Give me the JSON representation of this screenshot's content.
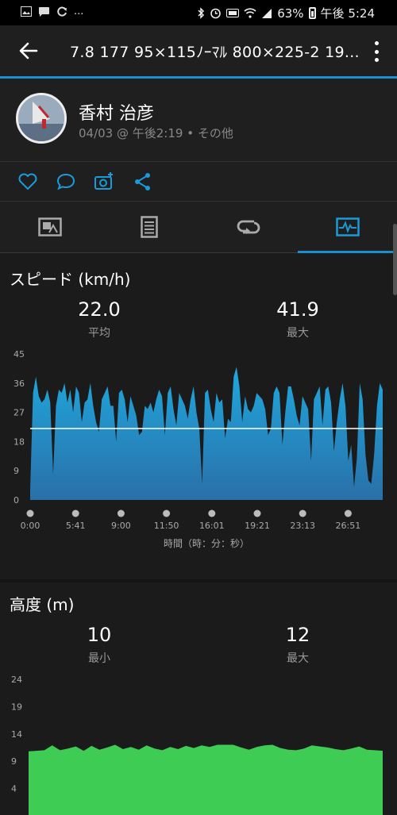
{
  "status_bar": {
    "left_icons": [
      "image-icon",
      "chat-bubble-icon",
      "sync-icon"
    ],
    "left_more": "...",
    "battery_pct": "63%",
    "time": "午後 5:24"
  },
  "app_bar": {
    "title": "7.8  177  95×115ﾉｰﾏﾙ  800×225-2  19..."
  },
  "header": {
    "user_name": "香村 治彦",
    "meta": "04/03 @ 午後2:19 • その他"
  },
  "tabs": [
    {
      "icon": "summary-icon",
      "selected": false
    },
    {
      "icon": "details-icon",
      "selected": false
    },
    {
      "icon": "laps-icon",
      "selected": false
    },
    {
      "icon": "chart-icon",
      "selected": true
    }
  ],
  "speed": {
    "title": "スピード (km/h)",
    "avg_value": "22.0",
    "avg_label": "平均",
    "max_value": "41.9",
    "max_label": "最大",
    "x_caption": "時間（時：分：秒）"
  },
  "altitude": {
    "title": "高度 (m)",
    "min_value": "10",
    "min_label": "最小",
    "max_value": "12",
    "max_label": "最大"
  },
  "chart_data": [
    {
      "type": "area",
      "ylabel": "スピード (km/h)",
      "xlabel": "時間（時：分：秒）",
      "ylim": [
        0,
        45
      ],
      "yticks": [
        "0",
        "9",
        "18",
        "27",
        "36",
        "45"
      ],
      "xticks": [
        "0:00",
        "5:41",
        "9:00",
        "11:50",
        "16:01",
        "19:21",
        "23:13",
        "26:51"
      ],
      "average_line": 22.0,
      "fill_color": "#1fa8dd",
      "line_color": "#ffffff",
      "values": [
        3,
        33,
        38,
        32,
        30,
        31,
        34,
        30,
        8,
        29,
        34,
        33,
        36,
        30,
        34,
        27,
        35,
        33,
        24,
        30,
        31,
        36,
        29,
        24,
        21,
        31,
        33,
        35,
        29,
        29,
        18,
        33,
        34,
        31,
        24,
        32,
        29,
        26,
        20,
        21,
        29,
        28,
        30,
        27,
        31,
        34,
        32,
        20,
        33,
        35,
        28,
        23,
        33,
        31,
        29,
        25,
        31,
        35,
        27,
        22,
        5,
        33,
        34,
        28,
        24,
        33,
        30,
        31,
        19,
        25,
        24,
        38,
        41,
        35,
        24,
        32,
        28,
        27,
        29,
        33,
        32,
        31,
        28,
        20,
        22,
        33,
        35,
        33,
        17,
        27,
        35,
        35,
        31,
        26,
        23,
        32,
        30,
        28,
        12,
        31,
        33,
        35,
        23,
        34,
        35,
        30,
        15,
        24,
        31,
        36,
        29,
        12,
        17,
        4,
        13,
        36,
        31,
        14,
        6,
        5,
        14,
        29,
        36,
        34
      ]
    },
    {
      "type": "area",
      "ylabel": "高度 (m)",
      "ylim": [
        0,
        24
      ],
      "yticks": [
        "4",
        "9",
        "14",
        "19",
        "24"
      ],
      "fill_color": "#3fcc55",
      "values": [
        10.8,
        10.9,
        11.0,
        11.9,
        11.0,
        11.3,
        11.7,
        10.9,
        11.8,
        11.1,
        11.5,
        12.0,
        11.2,
        11.6,
        11.1,
        11.9,
        11.3,
        11.0,
        11.6,
        11.2,
        11.8,
        11.4,
        11.9,
        11.6,
        12.0,
        12.0,
        12.0,
        11.5,
        11.1,
        11.6,
        11.9,
        12.0,
        11.4,
        11.1,
        11.0,
        11.3,
        11.9,
        11.7,
        11.5,
        11.2,
        11.0,
        11.3,
        11.7,
        11.1,
        11.0,
        10.9
      ]
    }
  ]
}
